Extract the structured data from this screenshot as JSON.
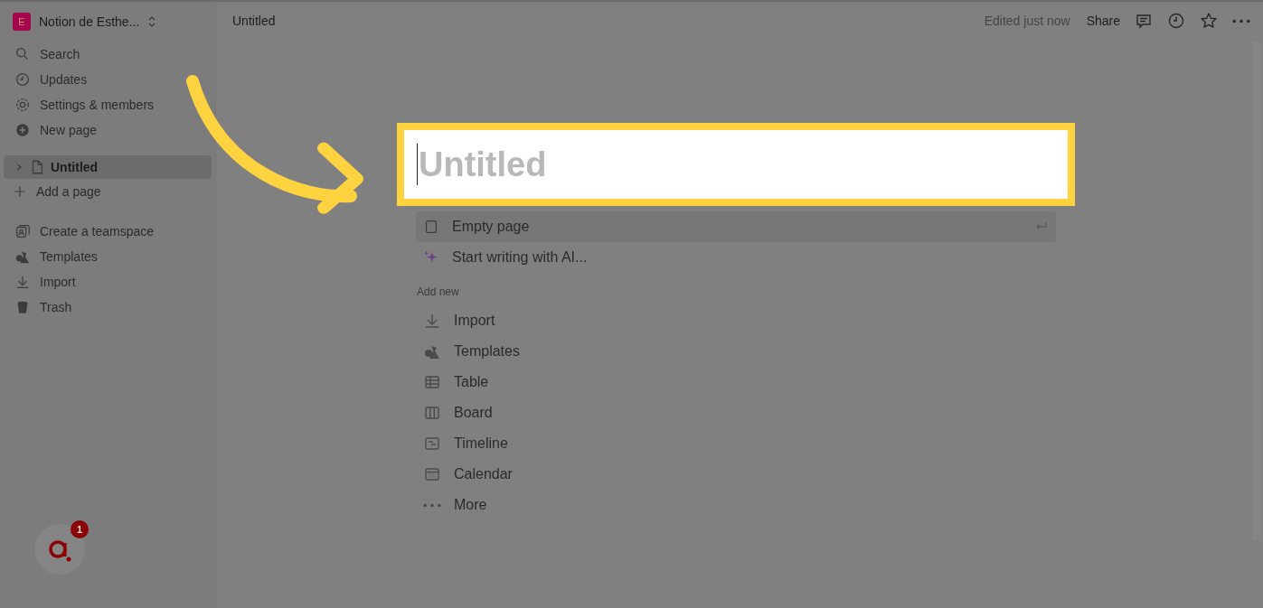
{
  "workspace": {
    "initial": "E",
    "name": "Notion de Esthe..."
  },
  "sidebar": {
    "nav": [
      {
        "label": "Search"
      },
      {
        "label": "Updates"
      },
      {
        "label": "Settings & members"
      },
      {
        "label": "New page"
      }
    ],
    "pages": [
      {
        "label": "Untitled",
        "selected": true,
        "expanded": false
      }
    ],
    "add_page": "Add a page",
    "tools": [
      {
        "label": "Create a teamspace"
      },
      {
        "label": "Templates"
      },
      {
        "label": "Import"
      },
      {
        "label": "Trash"
      }
    ]
  },
  "topbar": {
    "breadcrumb": "Untitled",
    "status": "Edited just now",
    "share": "Share"
  },
  "page": {
    "title_placeholder": "Untitled",
    "options": [
      {
        "label": "Empty page",
        "selected": true
      },
      {
        "label": "Start writing with AI...",
        "selected": false
      }
    ],
    "add_new": {
      "heading": "Add new",
      "items": [
        {
          "label": "Import"
        },
        {
          "label": "Templates"
        },
        {
          "label": "Table"
        },
        {
          "label": "Board"
        },
        {
          "label": "Timeline"
        },
        {
          "label": "Calendar"
        },
        {
          "label": "More"
        }
      ]
    }
  },
  "widget": {
    "badge": "1"
  }
}
